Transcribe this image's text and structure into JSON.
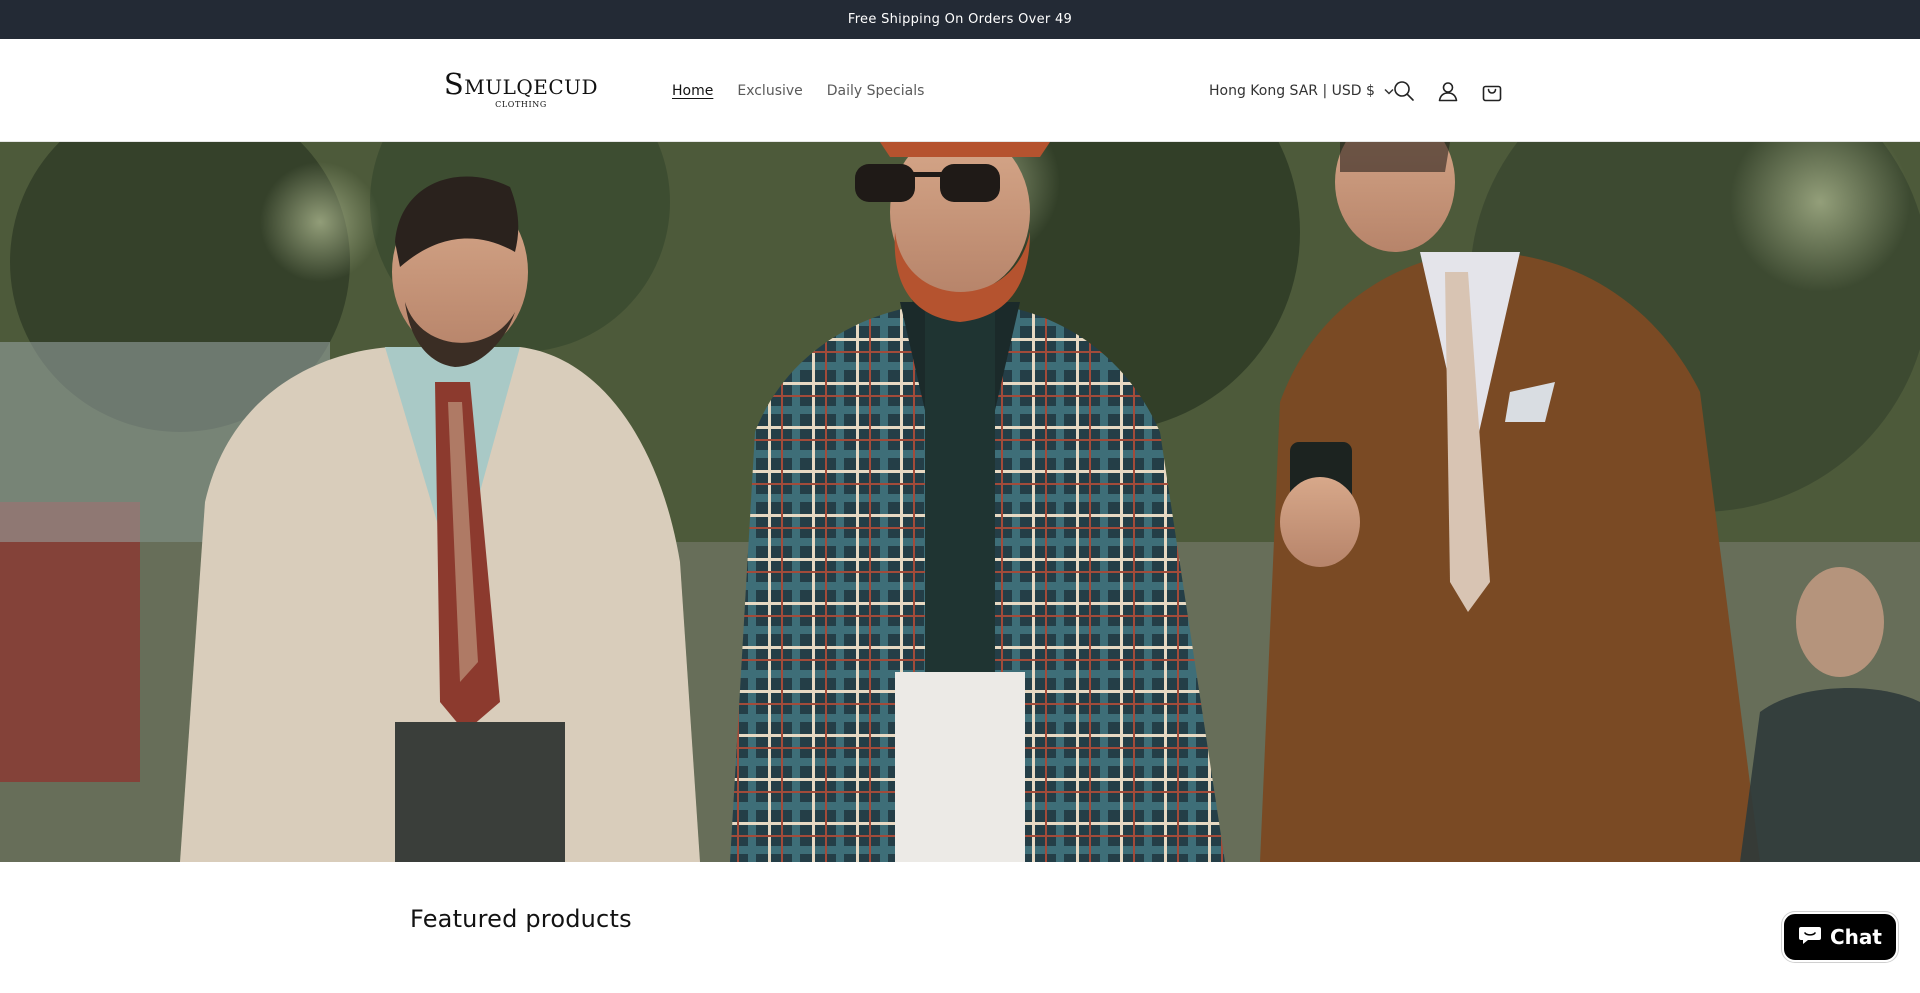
{
  "announcement": {
    "text": "Free Shipping On Orders Over   49"
  },
  "header": {
    "logo": {
      "main": "Smulqecud",
      "sub": "CLOTHING"
    },
    "nav": [
      {
        "label": "Home",
        "active": true
      },
      {
        "label": "Exclusive",
        "active": false
      },
      {
        "label": "Daily Specials",
        "active": false
      }
    ],
    "locale": "Hong Kong SAR | USD $",
    "icons": [
      "search-icon",
      "account-icon",
      "cart-icon"
    ]
  },
  "hero": {
    "image": "three men in tailored suits walking outdoors"
  },
  "featured": {
    "title": "Featured products"
  },
  "chat": {
    "label": "Chat",
    "icon": "chat-bubble-icon"
  },
  "colors": {
    "announcement_bg": "#232a35",
    "chat_bg": "#000000",
    "text": "#121212"
  }
}
